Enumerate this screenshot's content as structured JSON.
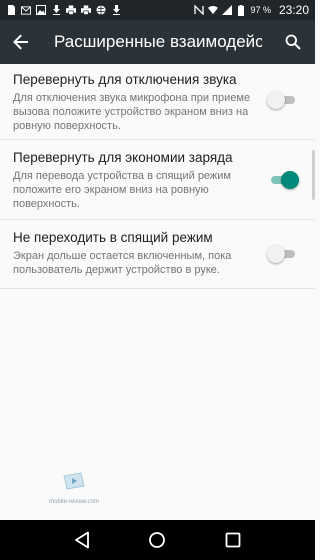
{
  "status_bar": {
    "icons": [
      "sim-icon",
      "gmail-icon",
      "image-icon",
      "download-icon",
      "print-icon",
      "print-icon",
      "globe-icon",
      "download-icon",
      "nfc-icon",
      "wifi-icon",
      "signal-icon",
      "battery-icon"
    ],
    "battery": "97 %",
    "time": "23:20"
  },
  "app_bar": {
    "title": "Расширенные взаимодейст...",
    "back_icon": "arrow-back-icon",
    "search_icon": "search-icon"
  },
  "settings": [
    {
      "title": "Перевернуть для отключения звука",
      "summary": "Для отключения звука микрофона при приеме вызова положите устройство экраном вниз на ровную поверхность.",
      "enabled": false
    },
    {
      "title": "Перевернуть для экономии заряда",
      "summary": "Для перевода устройства в спящий режим положите его экраном вниз на ровную поверхность.",
      "enabled": true
    },
    {
      "title": "Не переходить в спящий режим",
      "summary": "Экран дольше остается включенным, пока пользователь держит устройство в руке.",
      "enabled": false
    }
  ],
  "watermark": {
    "text": "mobile-review.com"
  },
  "nav_bar": {
    "back": "nav-back-icon",
    "home": "nav-home-icon",
    "recents": "nav-recents-icon"
  },
  "colors": {
    "accent": "#00897b",
    "app_bar": "#2b3338",
    "status_bar": "#20262a"
  }
}
